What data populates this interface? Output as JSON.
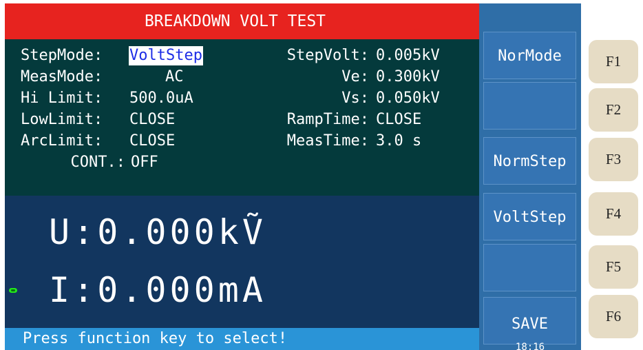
{
  "title": "BREAKDOWN VOLT TEST",
  "params": {
    "step_mode": {
      "label": "StepMode:",
      "value": "VoltStep"
    },
    "meas_mode": {
      "label": "MeasMode:",
      "value": "AC"
    },
    "hi_limit": {
      "label": "Hi Limit:",
      "value": "500.0uA"
    },
    "low_limit": {
      "label": "LowLimit:",
      "value": "CLOSE"
    },
    "arc_limit": {
      "label": "ArcLimit:",
      "value": "CLOSE"
    },
    "cont": {
      "label": "CONT.:",
      "value": "OFF"
    },
    "step_volt": {
      "label": "StepVolt:",
      "value": "0.005kV"
    },
    "ve": {
      "label": "Ve:",
      "value": "0.300kV"
    },
    "vs": {
      "label": "Vs:",
      "value": "0.050kV"
    },
    "ramp_time": {
      "label": "RampTime:",
      "value": "CLOSE"
    },
    "meas_time": {
      "label": "MeasTime:",
      "value": "3.0 s"
    }
  },
  "measurement": {
    "voltage": "U:0.000kṼ",
    "current": "I:0.000mA"
  },
  "status": "Press function key to select!",
  "softkeys": [
    "NorMode",
    "",
    "NormStep",
    "VoltStep",
    "",
    "SAVE"
  ],
  "clock": "18:16",
  "function_keys": [
    "F1",
    "F2",
    "F3",
    "F4",
    "F5",
    "F6"
  ],
  "colors": {
    "title_bar": "#e7231f",
    "params_bg": "#043a3c",
    "measure_bg": "#12365f",
    "status_bar": "#2a94d7",
    "softkey_panel": "#2f6ea7",
    "highlight_bg": "#ffffff",
    "highlight_text": "#1e2ee6",
    "indicator": "#23e81a",
    "function_key": "#e6dcc5"
  },
  "icons": {
    "indicator": "status-led-icon"
  }
}
